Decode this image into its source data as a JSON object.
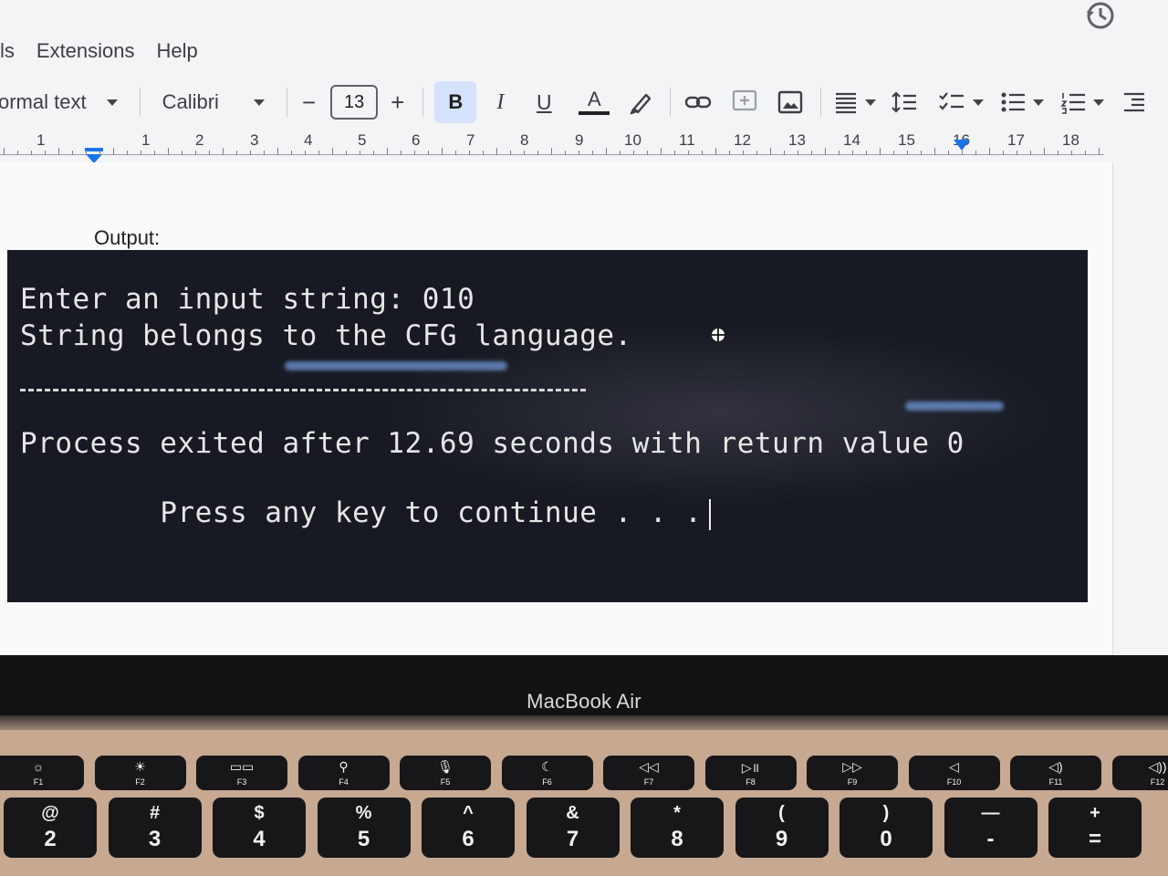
{
  "menu": {
    "items": [
      "ls",
      "Extensions",
      "Help"
    ]
  },
  "toolbar": {
    "style_label": "ormal text",
    "font_label": "Calibri",
    "decrease_label": "−",
    "font_size": "13",
    "increase_label": "+",
    "bold_label": "B",
    "italic_label": "I",
    "underline_label": "U",
    "text_color_label": "A",
    "text_color_hex": "#202124",
    "bold_active_bg": "#d6e2fb"
  },
  "ruler": {
    "numbers": [
      "1",
      "1",
      "2",
      "3",
      "4",
      "5",
      "6",
      "7",
      "8",
      "9",
      "10",
      "11",
      "12",
      "13",
      "14",
      "15",
      "16",
      "17",
      "18"
    ]
  },
  "document": {
    "output_label": "Output:",
    "console_lines": [
      "Enter an input string: 010",
      "String belongs to the CFG language.",
      "Process exited after 12.69 seconds with return value 0",
      "Press any key to continue . . ."
    ],
    "console_bg": "#171a22"
  },
  "laptop": {
    "brand": "MacBook Air",
    "fkeys": [
      {
        "sym": "☼",
        "label": "F1"
      },
      {
        "sym": "☀",
        "label": "F2"
      },
      {
        "sym": "▭▭",
        "label": "F3"
      },
      {
        "sym": "⚲",
        "label": "F4"
      },
      {
        "sym": "🎙",
        "label": "F5"
      },
      {
        "sym": "☾",
        "label": "F6"
      },
      {
        "sym": "◁◁",
        "label": "F7"
      },
      {
        "sym": "▷॥",
        "label": "F8"
      },
      {
        "sym": "▷▷",
        "label": "F9"
      },
      {
        "sym": "◁",
        "label": "F10"
      },
      {
        "sym": "◁)",
        "label": "F11"
      },
      {
        "sym": "◁))",
        "label": "F12"
      }
    ],
    "numkeys": [
      {
        "top": "@",
        "bot": "2"
      },
      {
        "top": "#",
        "bot": "3"
      },
      {
        "top": "$",
        "bot": "4"
      },
      {
        "top": "%",
        "bot": "5"
      },
      {
        "top": "^",
        "bot": "6"
      },
      {
        "top": "&",
        "bot": "7"
      },
      {
        "top": "*",
        "bot": "8"
      },
      {
        "top": "(",
        "bot": "9"
      },
      {
        "top": ")",
        "bot": "0"
      },
      {
        "top": "—",
        "bot": "-"
      },
      {
        "top": "+",
        "bot": "="
      }
    ]
  }
}
